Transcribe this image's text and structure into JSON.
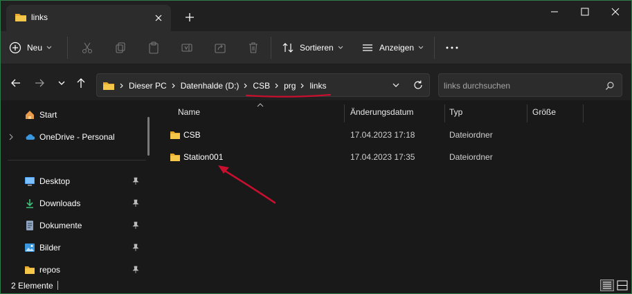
{
  "window": {
    "border_color": "#2f7d4a"
  },
  "tab": {
    "title": "links",
    "icon": "folder-icon"
  },
  "window_controls": {
    "minimize": "minimize-icon",
    "maximize": "maximize-icon",
    "close": "close-icon"
  },
  "toolbar": {
    "new_label": "Neu",
    "sort_label": "Sortieren",
    "view_label": "Anzeigen",
    "icons": [
      "plus-circle-icon",
      "cut-icon",
      "copy-icon",
      "paste-icon",
      "rename-icon",
      "share-icon",
      "delete-icon",
      "sort-icon",
      "view-icon",
      "more-icon"
    ]
  },
  "navigation": {
    "back": "back-icon",
    "forward": "forward-icon",
    "recent": "chevron-down-icon",
    "up": "up-icon"
  },
  "address": {
    "breadcrumbs": [
      "Dieser PC",
      "Datenhalde (D:)",
      "CSB",
      "prg",
      "links"
    ]
  },
  "search": {
    "placeholder": "links durchsuchen"
  },
  "sidebar": {
    "items": [
      {
        "label": "Start",
        "icon": "home-icon"
      },
      {
        "label": "OneDrive - Personal",
        "icon": "cloud-icon"
      },
      {
        "label": "Desktop",
        "icon": "desktop-icon",
        "pinned": true
      },
      {
        "label": "Downloads",
        "icon": "download-icon",
        "pinned": true
      },
      {
        "label": "Dokumente",
        "icon": "document-icon",
        "pinned": true
      },
      {
        "label": "Bilder",
        "icon": "picture-icon",
        "pinned": true
      },
      {
        "label": "repos",
        "icon": "folder-icon",
        "pinned": true
      }
    ]
  },
  "file_list": {
    "columns": [
      "Name",
      "Änderungsdatum",
      "Typ",
      "Größe"
    ],
    "rows": [
      {
        "name": "CSB",
        "date": "17.04.2023 17:18",
        "type": "Dateiordner",
        "size": ""
      },
      {
        "name": "Station001",
        "date": "17.04.2023 17:35",
        "type": "Dateiordner",
        "size": ""
      }
    ]
  },
  "status": {
    "item_count": "2 Elemente"
  },
  "colors": {
    "folder": "#f4c64a",
    "annotation": "#c8102e",
    "accent": "#4aa3ff"
  }
}
